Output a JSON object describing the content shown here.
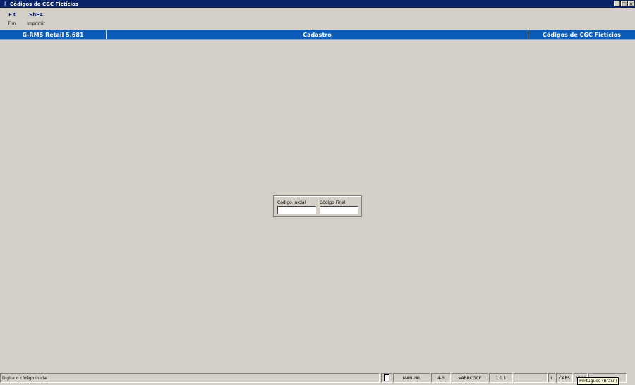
{
  "window": {
    "title": "Códigos de CGC Fictícios",
    "app_icon": "key-icon",
    "controls": [
      "_",
      "□",
      "×"
    ]
  },
  "toolbar": {
    "keys": [
      {
        "key": "F3",
        "label": "Fim"
      },
      {
        "key": "ShF4",
        "label": "Imprimir"
      }
    ]
  },
  "header": {
    "product": "G-RMS Retail 5.681",
    "module": "Cadastro",
    "screen": "Códigos de CGC Fictícios",
    "color": "#0a5cb8"
  },
  "form": {
    "initial_label": "Código Inicial",
    "initial_value": "",
    "final_label": "Código Final",
    "final_value": ""
  },
  "statusbar": {
    "message": "Digite o código inicial",
    "mode": "MANUAL",
    "version_code": "4-3",
    "program": "VABRCGCF",
    "release": "1.0.1",
    "blank": "",
    "flag_l": "L",
    "caps": "CAPS",
    "num": "NUM"
  },
  "tooltip": {
    "text": "Português (Brasil)"
  }
}
